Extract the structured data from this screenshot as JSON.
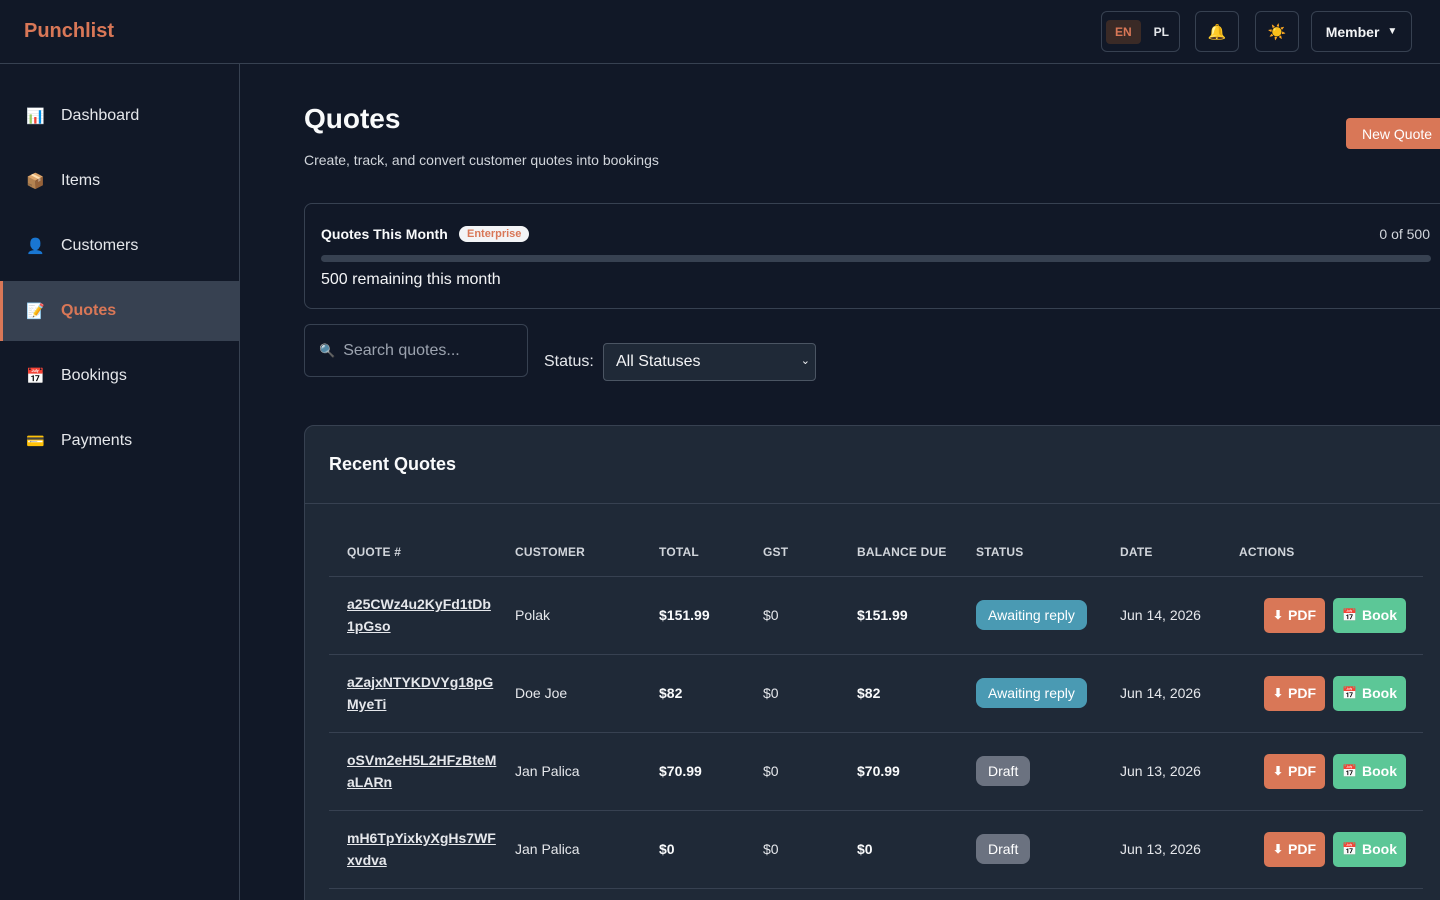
{
  "app": {
    "brand": "Punchlist"
  },
  "topbar": {
    "languages": [
      {
        "code": "EN",
        "active": true
      },
      {
        "code": "PL",
        "active": false
      }
    ],
    "notifications_icon": "bell-icon",
    "theme_icon": "sun-icon",
    "theme_glyph": "☀️",
    "notifications_glyph": "🔔",
    "member_label": "Member",
    "member_caret": "▼"
  },
  "sidebar": {
    "items": [
      {
        "label": "Dashboard",
        "icon": "bar-chart-icon",
        "glyph": "📊",
        "active": false
      },
      {
        "label": "Items",
        "icon": "package-icon",
        "glyph": "📦",
        "active": false
      },
      {
        "label": "Customers",
        "icon": "user-icon",
        "glyph": "👤",
        "active": false
      },
      {
        "label": "Quotes",
        "icon": "memo-icon",
        "glyph": "📝",
        "active": true
      },
      {
        "label": "Bookings",
        "icon": "calendar-icon",
        "glyph": "📅",
        "active": false
      },
      {
        "label": "Payments",
        "icon": "credit-card-icon",
        "glyph": "💳",
        "active": false
      }
    ]
  },
  "page": {
    "title": "Quotes",
    "subtitle": "Create, track, and convert customer quotes into bookings",
    "new_button": "New Quote"
  },
  "usage": {
    "title": "Quotes This Month",
    "plan_badge": "Enterprise",
    "count_text": "0 of 500",
    "used": 0,
    "limit": 500,
    "remaining_text": "500 remaining this month"
  },
  "filters": {
    "search_placeholder": "Search quotes...",
    "search_glyph": "🔍",
    "status_label": "Status:",
    "status_selected": "All Statuses",
    "status_chevron": "⌄"
  },
  "table": {
    "title": "Recent Quotes",
    "columns": [
      "QUOTE #",
      "CUSTOMER",
      "TOTAL",
      "GST",
      "BALANCE DUE",
      "STATUS",
      "DATE",
      "ACTIONS"
    ],
    "pdf_label": "PDF",
    "pdf_glyph": "⬇",
    "book_label": "Book",
    "book_glyph": "📅",
    "rows": [
      {
        "id": "a25CWz4u2KyFd1tDb1pGso",
        "customer": "Polak",
        "total": "$151.99",
        "gst": "$0",
        "balance": "$151.99",
        "status": "Awaiting reply",
        "status_kind": "awaiting",
        "date": "Jun 14, 2026"
      },
      {
        "id": "aZajxNTYKDVYg18pGMyeTi",
        "customer": "Doe Joe",
        "total": "$82",
        "gst": "$0",
        "balance": "$82",
        "status": "Awaiting reply",
        "status_kind": "awaiting",
        "date": "Jun 14, 2026"
      },
      {
        "id": "oSVm2eH5L2HFzBteMaLARn",
        "customer": "Jan Palica",
        "total": "$70.99",
        "gst": "$0",
        "balance": "$70.99",
        "status": "Draft",
        "status_kind": "draft",
        "date": "Jun 13, 2026"
      },
      {
        "id": "mH6TpYixkyXgHs7WFxvdva",
        "customer": "Jan Palica",
        "total": "$0",
        "gst": "$0",
        "balance": "$0",
        "status": "Draft",
        "status_kind": "draft",
        "date": "Jun 13, 2026"
      }
    ]
  },
  "colors": {
    "accent": "#d97757",
    "book_green": "#5cc797",
    "awaiting_blue": "#4a9ab3",
    "draft_gray": "#6b7280",
    "background": "#111827",
    "card": "#1f2937"
  }
}
